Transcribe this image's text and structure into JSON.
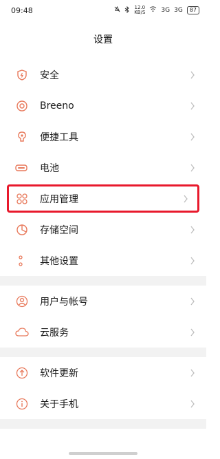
{
  "status_bar": {
    "time": "09:48",
    "speed_top": "12.0",
    "speed_bottom": "KB/S",
    "signal_1": "3G",
    "signal_2": "3G",
    "battery": "87"
  },
  "page": {
    "title": "设置"
  },
  "groups": [
    {
      "items": [
        {
          "label": "安全",
          "icon": "shield-icon"
        },
        {
          "label": "Breeno",
          "icon": "breeno-icon"
        },
        {
          "label": "便捷工具",
          "icon": "tools-icon"
        },
        {
          "label": "电池",
          "icon": "battery-icon"
        },
        {
          "label": "应用管理",
          "icon": "apps-icon",
          "highlighted": true
        },
        {
          "label": "存储空间",
          "icon": "storage-icon"
        },
        {
          "label": "其他设置",
          "icon": "more-icon"
        }
      ]
    },
    {
      "items": [
        {
          "label": "用户与帐号",
          "icon": "user-icon"
        },
        {
          "label": "云服务",
          "icon": "cloud-icon"
        }
      ]
    },
    {
      "items": [
        {
          "label": "软件更新",
          "icon": "update-icon"
        },
        {
          "label": "关于手机",
          "icon": "info-icon"
        }
      ]
    }
  ],
  "colors": {
    "accent": "#e8795b",
    "highlight_border": "#e8192c"
  }
}
